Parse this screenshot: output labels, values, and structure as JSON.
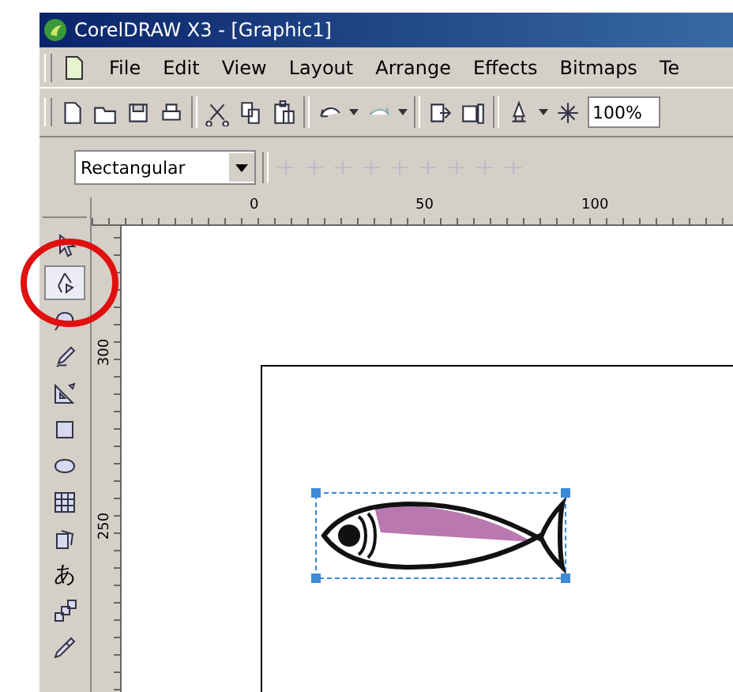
{
  "window": {
    "title": "CorelDRAW X3 - [Graphic1]"
  },
  "menu": [
    {
      "label": "File"
    },
    {
      "label": "Edit"
    },
    {
      "label": "View"
    },
    {
      "label": "Layout"
    },
    {
      "label": "Arrange"
    },
    {
      "label": "Effects"
    },
    {
      "label": "Bitmaps"
    },
    {
      "label": "Te"
    }
  ],
  "toolbar": {
    "zoom_level": "100%"
  },
  "property_bar": {
    "shape_dropdown": "Rectangular"
  },
  "horizontal_ruler": [
    "0",
    "50",
    "100"
  ],
  "vertical_ruler": [
    "300",
    "250"
  ],
  "toolbox": [
    {
      "kind": "icon",
      "selected": false
    },
    {
      "kind": "icon",
      "selected": true
    },
    {
      "kind": "icon",
      "selected": false
    },
    {
      "kind": "icon",
      "selected": false
    },
    {
      "kind": "icon",
      "selected": false
    },
    {
      "kind": "icon",
      "selected": false
    },
    {
      "kind": "icon",
      "selected": false
    },
    {
      "kind": "icon",
      "selected": false
    },
    {
      "kind": "icon",
      "selected": false
    },
    {
      "kind": "glyph",
      "label": "あ",
      "selected": false
    },
    {
      "kind": "icon",
      "selected": false
    },
    {
      "kind": "icon",
      "selected": false
    }
  ]
}
